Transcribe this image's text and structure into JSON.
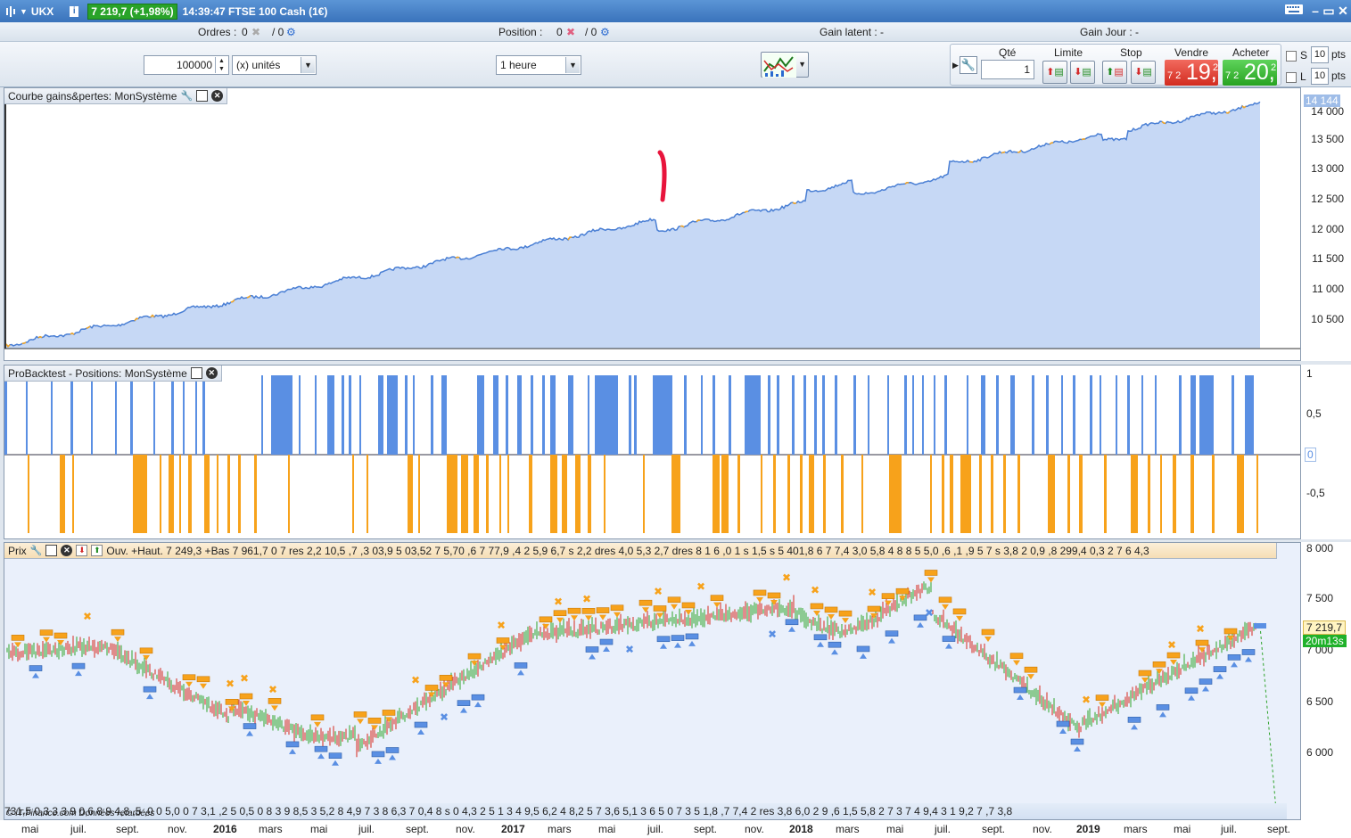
{
  "titlebar": {
    "symbol": "UKX",
    "price_change": "7 219,7 (+1,98%)",
    "info": "14:39:47 FTSE 100 Cash (1€)"
  },
  "infobar": {
    "orders_label": "Ordres :",
    "orders_value": "0",
    "orders_total": "/ 0",
    "position_label": "Position :",
    "position_value": "0",
    "position_total": "/ 0",
    "latent_gain": "Gain latent : -",
    "day_gain": "Gain Jour : -"
  },
  "toolbar": {
    "quantity": "100000",
    "unit": "(x) unités",
    "timeframe": "1 heure",
    "qty_label": "Qté",
    "qty_value": "1",
    "limit_label": "Limite",
    "stop_label": "Stop",
    "sell_label": "Vendre",
    "buy_label": "Acheter",
    "sell_small": "7 2",
    "sell_big": "19,",
    "sell_sup": "2",
    "buy_small": "7 2",
    "buy_big": "20,",
    "buy_sup": "2",
    "s_label": "S",
    "l_label": "L",
    "pts_value_s": "10",
    "pts_value_l": "10",
    "pts_label": "pts"
  },
  "equity_panel": {
    "title": "Courbe gains&pertes: MonSystème",
    "current": "14 144",
    "axis": [
      "14 000",
      "13 500",
      "13 000",
      "12 500",
      "12 000",
      "11 500",
      "11 000",
      "10 500"
    ]
  },
  "positions_panel": {
    "title": "ProBacktest - Positions: MonSystème",
    "axis": [
      "1",
      "0,5",
      "0",
      "-0,5"
    ]
  },
  "price_panel": {
    "title": "Prix",
    "ticker_text": "Ouv. +Haut. 7 249,3 +Bas 7 961,7  0 7 res 2,2 10,5 ,7 ,3 03,9 5 03,52 7 5,70 ,6 7 77,9 ,4 2 5,9 6,7 s 2,2 dres 4,0 5,3 2,7 dres 8 1 6 ,0 1 s 1,5 s 5 401,8 6 7 7,4 3,0 5,8 4 8 8 5 5,0 ,6 ,1 ,9 5 7 s 3,8 2 0,9 ,8 299,4 0,3 2 7 6 4,3",
    "axis": [
      "8 000",
      "7 500",
      "7 000",
      "6 500",
      "6 000"
    ],
    "last_price": "7 219,7",
    "countdown": "20m13s",
    "footer_text": "731,5 0,3 3 3 9 0,6 8 9 4,8 ,5 ,0 0 5,0 0 7 3,1 ,2 5 0,5 0 8 3 9 8,5 3 5,2 8 4,9 7 3 8 6,3 7 0,4 8 s 0 4,3 2 5 1 3 4 9,5 6,2 4 8,2 5 7 3,6 5,1 3 6 5 0 7 3 5 1,8 ,7 7,4 2 res 3,8 6,0 2 9 ,6 1,5 5,8 2 7 3 7 4 9,4 3 1 9,2 7 ,7 3,8",
    "copyright": "© IT-Finance.com Données retardées"
  },
  "date_axis": [
    "mai",
    "juil.",
    "sept.",
    "nov.",
    "2016",
    "mars",
    "mai",
    "juil.",
    "sept.",
    "nov.",
    "2017",
    "mars",
    "mai",
    "juil.",
    "sept.",
    "nov.",
    "2018",
    "mars",
    "mai",
    "juil.",
    "sept.",
    "nov.",
    "2019",
    "mars",
    "mai",
    "juil.",
    "sept."
  ],
  "colors": {
    "equity_fill": "#c6d8f5",
    "equity_line": "#4a7fd4",
    "equity_loss": "#f5a623",
    "long_bar": "#5a8fe3",
    "short_bar": "#f7a21b",
    "marker_red": "#e8143c",
    "buy_green": "#2ea32a",
    "sell_red": "#d7281c"
  }
}
